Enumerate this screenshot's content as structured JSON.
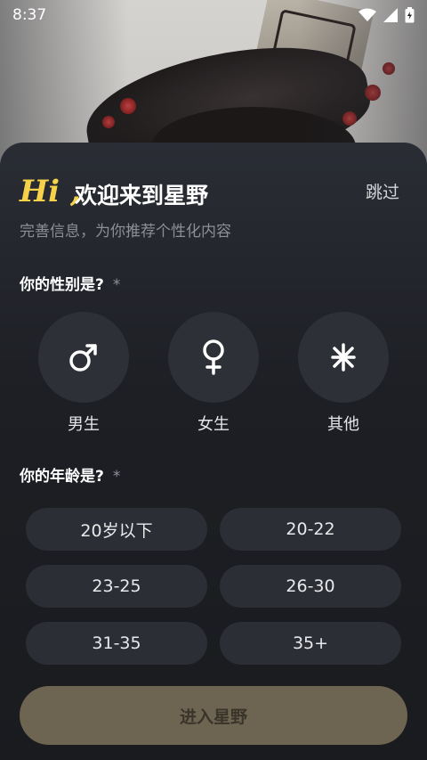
{
  "status_bar": {
    "time": "8:37"
  },
  "header": {
    "hi": "Hi ,",
    "title": "欢迎来到星野",
    "skip": "跳过",
    "subtitle": "完善信息，为你推荐个性化内容"
  },
  "gender_section": {
    "title": "你的性别是?",
    "required_mark": "*",
    "options": [
      {
        "label": "男生",
        "icon": "male-symbol-icon",
        "glyph": "♂"
      },
      {
        "label": "女生",
        "icon": "female-symbol-icon",
        "glyph": "♀"
      },
      {
        "label": "其他",
        "icon": "other-gender-icon",
        "glyph": "⚹"
      }
    ]
  },
  "age_section": {
    "title": "你的年龄是?",
    "required_mark": "*",
    "options": [
      "20岁以下",
      "20-22",
      "23-25",
      "26-30",
      "31-35",
      "35+"
    ]
  },
  "enter_button": {
    "label": "进入星野"
  },
  "colors": {
    "accent_yellow": "#f5d24a",
    "sheet_bg": "#1d1f24",
    "option_bg": "#2c2e35",
    "enter_button_bg": "#6e6452"
  }
}
